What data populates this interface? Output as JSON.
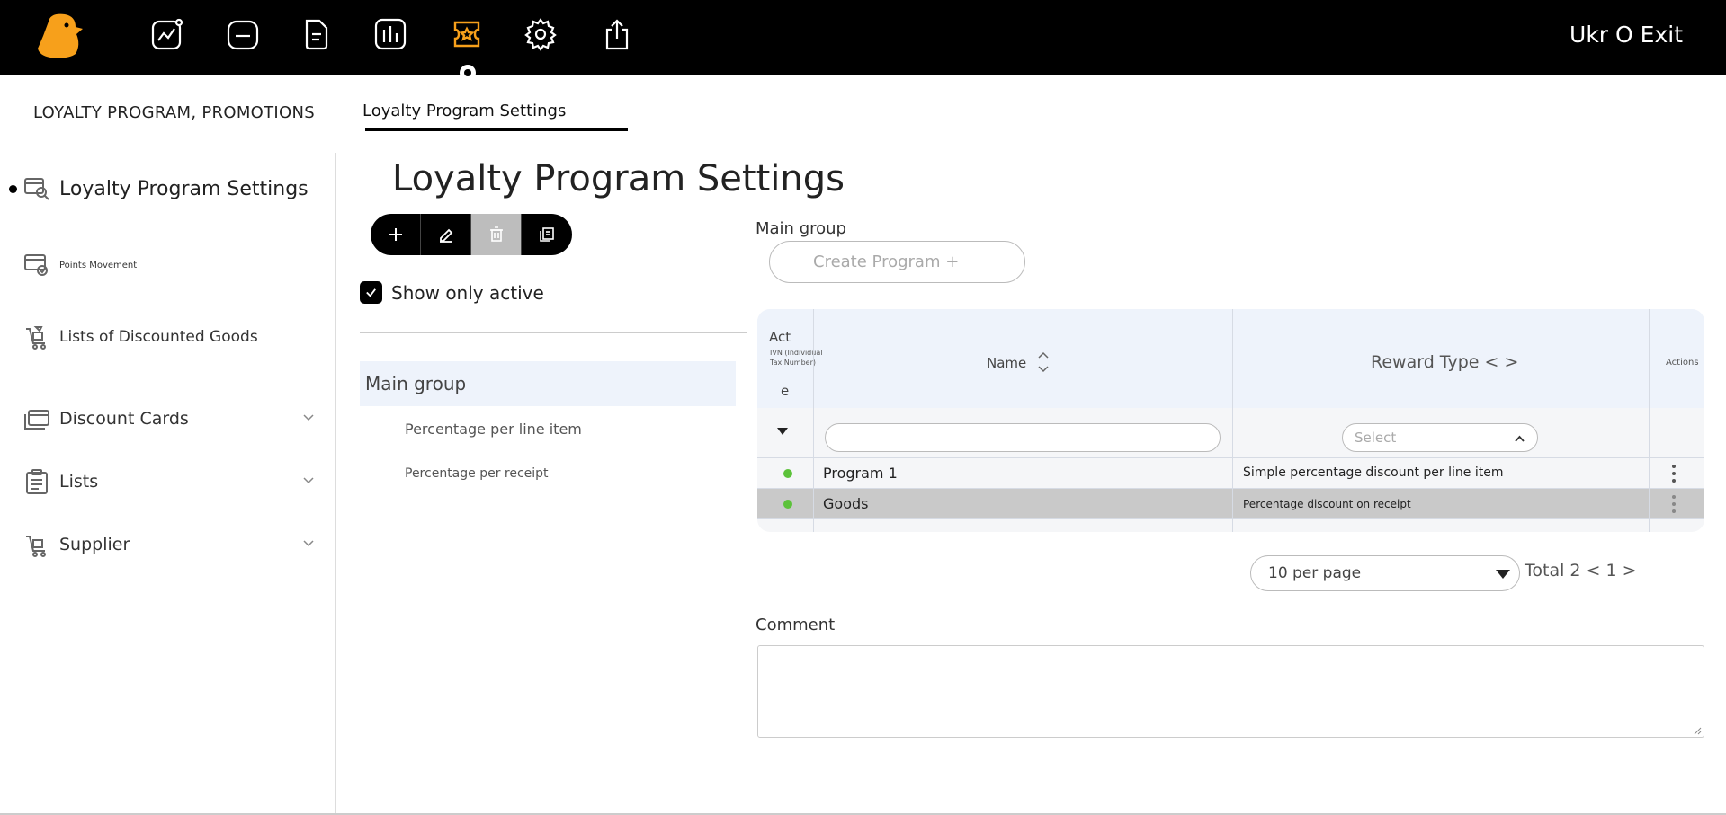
{
  "header": {
    "user_exit": "Ukr O Exit",
    "nav_icons": [
      "analytics-icon",
      "folder-icon",
      "document-icon",
      "reports-icon",
      "loyalty-icon",
      "gear-icon",
      "export-icon"
    ],
    "active_icon": "loyalty-icon"
  },
  "tabs": {
    "section": "LOYALTY PROGRAM, PROMOTIONS",
    "active": "Loyalty Program Settings"
  },
  "sidebar": {
    "items": [
      {
        "label": "Loyalty Program Settings",
        "icon": "loyalty-settings-icon",
        "active": true
      },
      {
        "label": "Points Movement",
        "icon": "points-movement-icon"
      },
      {
        "label": "Lists of Discounted Goods",
        "icon": "discounted-goods-icon"
      },
      {
        "label": "Discount Cards",
        "icon": "discount-cards-icon",
        "expandable": true
      },
      {
        "label": "Lists",
        "icon": "lists-icon",
        "expandable": true
      },
      {
        "label": "Supplier",
        "icon": "supplier-icon",
        "expandable": true
      }
    ]
  },
  "main": {
    "title": "Loyalty Program Settings",
    "show_only_active": "Show only active",
    "groups": {
      "main": "Main group",
      "children": [
        "Percentage per line item",
        "Percentage per receipt"
      ]
    },
    "right_group_label": "Main group",
    "create_button": "Create Program +",
    "table": {
      "headers": {
        "act": "Act",
        "act_sub": "IVN (Individual Tax Number)",
        "act_tail": "e",
        "name": "Name",
        "reward": "Reward Type < >",
        "actions": "Actions"
      },
      "filter_select_placeholder": "Select",
      "rows": [
        {
          "active": true,
          "name": "Program 1",
          "reward": "Simple percentage discount per line item",
          "selected": false
        },
        {
          "active": true,
          "name": "Goods",
          "reward": "Percentage discount on receipt",
          "selected": true
        }
      ]
    },
    "pagination": {
      "per_page": "10 per page",
      "total": "Total 2 < 1 >"
    },
    "comment_label": "Comment",
    "comment_value": ""
  },
  "colors": {
    "accent": "#f7a01b",
    "active_green": "#5cc23a",
    "header_bg": "#eef3fb"
  }
}
